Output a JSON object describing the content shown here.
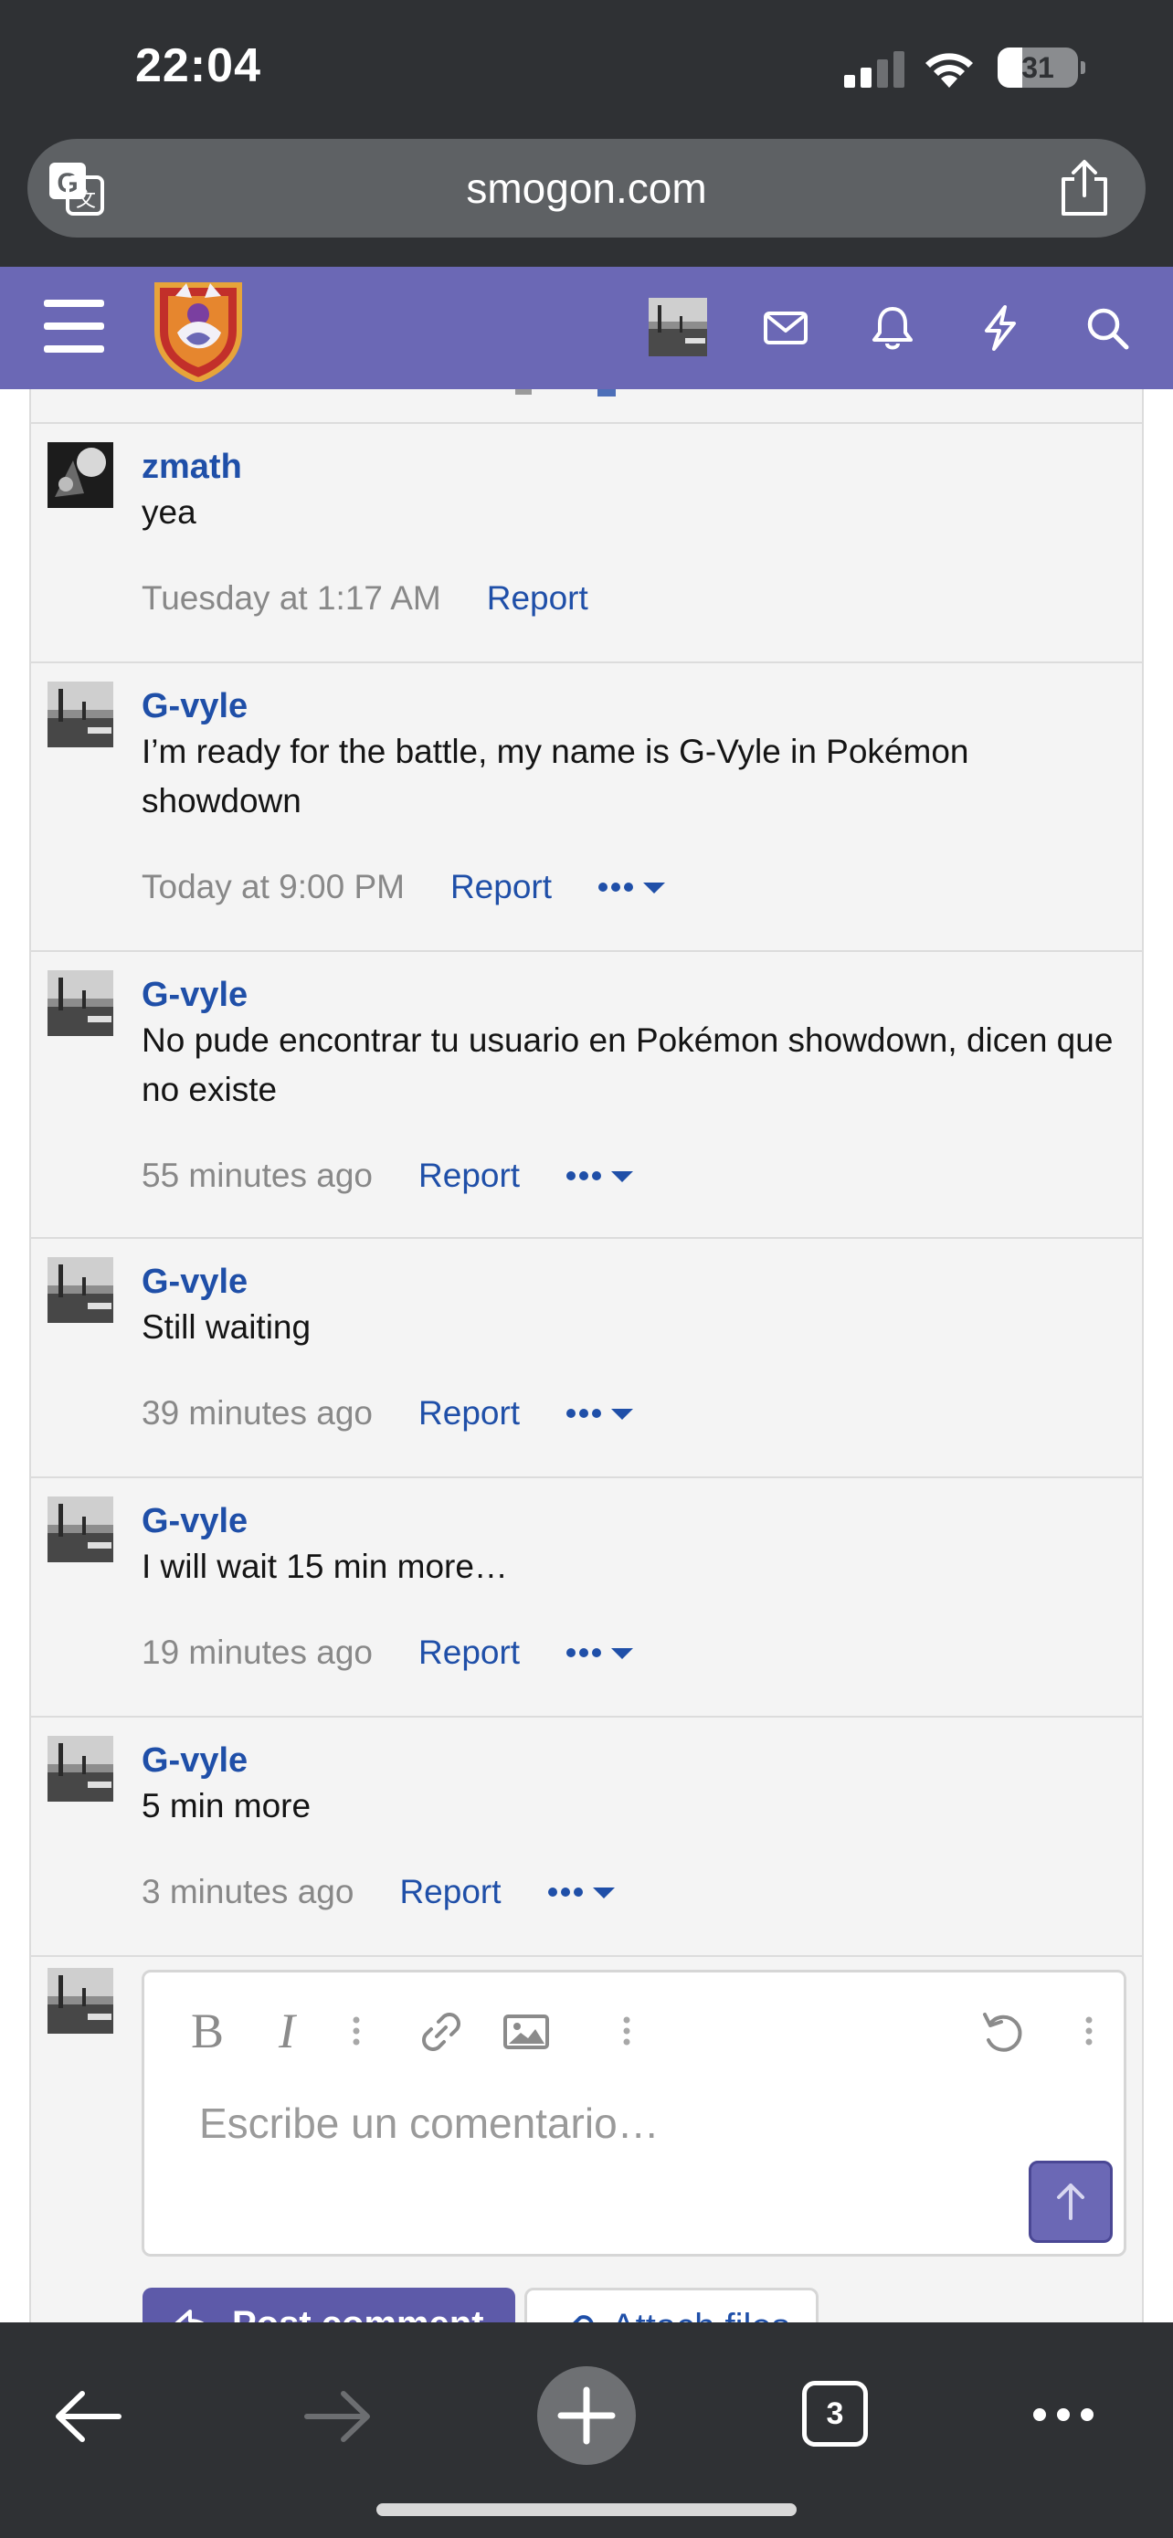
{
  "status_bar": {
    "time": "22:04",
    "battery": "31",
    "battery_level": 0.31
  },
  "browser": {
    "url": "smogon.com",
    "tab_count": "3"
  },
  "comments": [
    {
      "user": "zmath",
      "text": "yea",
      "time": "Tuesday at 1:17 AM",
      "report": "Report",
      "has_more": false
    },
    {
      "user": "G-vyle",
      "text": "I’m ready for the battle, my name is G-Vyle in Pokémon showdown",
      "time": "Today at 9:00 PM",
      "report": "Report",
      "has_more": true
    },
    {
      "user": "G-vyle",
      "text": "No pude encontrar tu usuario en Pokémon showdown, dicen que no existe",
      "time": "55 minutes ago",
      "report": "Report",
      "has_more": true
    },
    {
      "user": "G-vyle",
      "text": "Still waiting",
      "time": "39 minutes ago",
      "report": "Report",
      "has_more": true
    },
    {
      "user": "G-vyle",
      "text": "I will wait 15 min more…",
      "time": "19 minutes ago",
      "report": "Report",
      "has_more": true
    },
    {
      "user": "G-vyle",
      "text": "5 min more",
      "time": "3 minutes ago",
      "report": "Report",
      "has_more": true
    }
  ],
  "editor": {
    "bold_label": "B",
    "italic_label": "I",
    "placeholder": "Escribe un comentario…",
    "post_label": "Post comment",
    "attach_label": "Attach files"
  },
  "colors": {
    "header": "#6b68b5",
    "link": "#1f4fa8",
    "chrome": "#2f3134"
  },
  "icons": [
    "translate-icon",
    "share-icon",
    "menu-icon",
    "envelope-icon",
    "bell-icon",
    "bolt-icon",
    "search-icon",
    "link-icon",
    "image-icon",
    "undo-icon",
    "arrow-up-icon",
    "back-icon",
    "forward-icon",
    "plus-icon",
    "tabs-icon",
    "more-icon"
  ]
}
